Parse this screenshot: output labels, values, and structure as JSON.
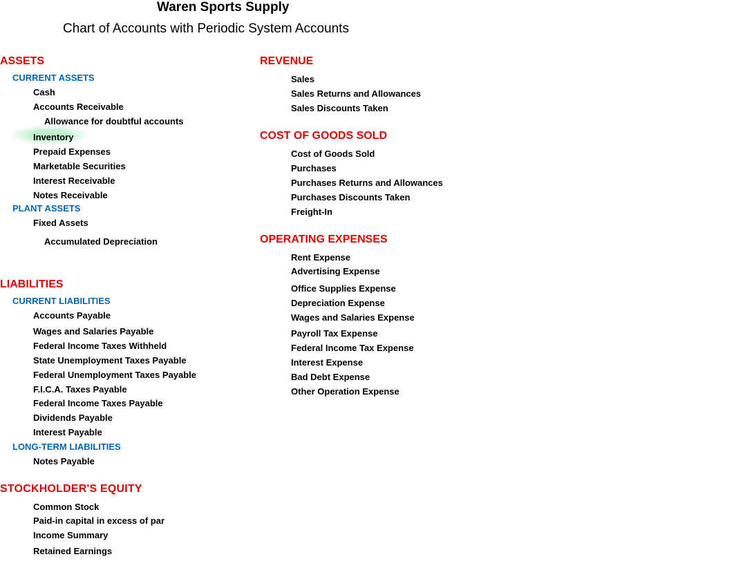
{
  "header": {
    "company": "Waren Sports Supply",
    "report_title": "Chart of Accounts with Periodic System Accounts"
  },
  "left": {
    "assets": {
      "label": "ASSETS",
      "current_assets": {
        "label": "CURRENT ASSETS",
        "items": {
          "cash": "Cash",
          "ar": "Accounts Receivable",
          "allowance": "Allowance for doubtful accounts",
          "inventory": "Inventory",
          "prepaid": "Prepaid Expenses",
          "marketable": "Marketable Securities",
          "interest_recv": "Interest Receivable",
          "notes_recv": "Notes Receivable"
        }
      },
      "plant_assets": {
        "label": "PLANT ASSETS",
        "items": {
          "fixed": "Fixed Assets",
          "acc_dep": "Accumulated Depreciation"
        }
      }
    },
    "liabilities": {
      "label": "LIABILITIES",
      "current": {
        "label": "CURRENT LIABILITIES",
        "items": {
          "ap": "Accounts Payable",
          "wages_pay": "Wages and Salaries Payable",
          "fed_withheld": "Federal Income Taxes Withheld",
          "state_unemp": "State Unemployment Taxes Payable",
          "fed_unemp": "Federal Unemployment Taxes Payable",
          "fica": "F.I.C.A. Taxes Payable",
          "fed_tax_pay": "Federal Income Taxes Payable",
          "div_pay": "Dividends Payable",
          "int_pay": "Interest Payable"
        }
      },
      "longterm": {
        "label": "LONG-TERM LIABILITIES",
        "items": {
          "notes_pay": "Notes Payable"
        }
      }
    },
    "equity": {
      "label": "STOCKHOLDER'S EQUITY",
      "items": {
        "common": "Common Stock",
        "paidin": "Paid-in capital in excess of par",
        "income_summary": "Income Summary",
        "retained": "Retained Earnings"
      }
    }
  },
  "right": {
    "revenue": {
      "label": "REVENUE",
      "items": {
        "sales": "Sales",
        "returns": "Sales Returns and Allowances",
        "discounts": "Sales Discounts Taken"
      }
    },
    "cogs": {
      "label": "COST OF GOODS SOLD",
      "items": {
        "cogs": "Cost of Goods Sold",
        "purchases": "Purchases",
        "preturns": "Purchases Returns and Allowances",
        "pdiscounts": "Purchases Discounts Taken",
        "freight": "Freight-In"
      }
    },
    "opex": {
      "label": "OPERATING EXPENSES",
      "items": {
        "rent": "Rent Expense",
        "adv": "Advertising Expense",
        "office": "Office Supplies Expense",
        "dep": "Depreciation Expense",
        "wages": "Wages and Salaries Expense",
        "payroll_tax": "Payroll Tax Expense",
        "fed_tax": "Federal Income Tax Expense",
        "interest": "Interest Expense",
        "bad_debt": "Bad Debt Expense",
        "other": "Other Operation Expense"
      }
    }
  }
}
